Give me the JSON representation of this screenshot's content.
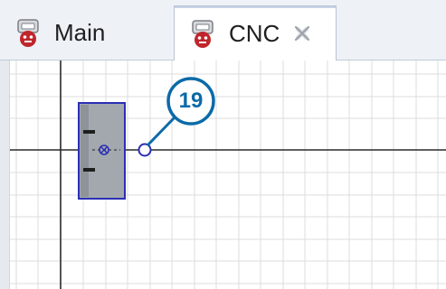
{
  "tabs": [
    {
      "label": "Main",
      "icon": "robot-head-icon",
      "active": false
    },
    {
      "label": "CNC",
      "icon": "robot-head-icon",
      "active": true,
      "close_icon": "close-tab-icon"
    }
  ],
  "canvas": {
    "grid": true,
    "callout": {
      "label": "19",
      "color": "#0b6aa8"
    },
    "block": {
      "icon": "terminal-symbol-icon",
      "fill": "#9da3ab",
      "border": "#2b2fb5"
    }
  },
  "colors": {
    "tabbar_bg": "#eef2f7",
    "icon_red": "#c0262b",
    "callout_blue": "#0b6aa8",
    "block_border": "#2b2fb5"
  }
}
